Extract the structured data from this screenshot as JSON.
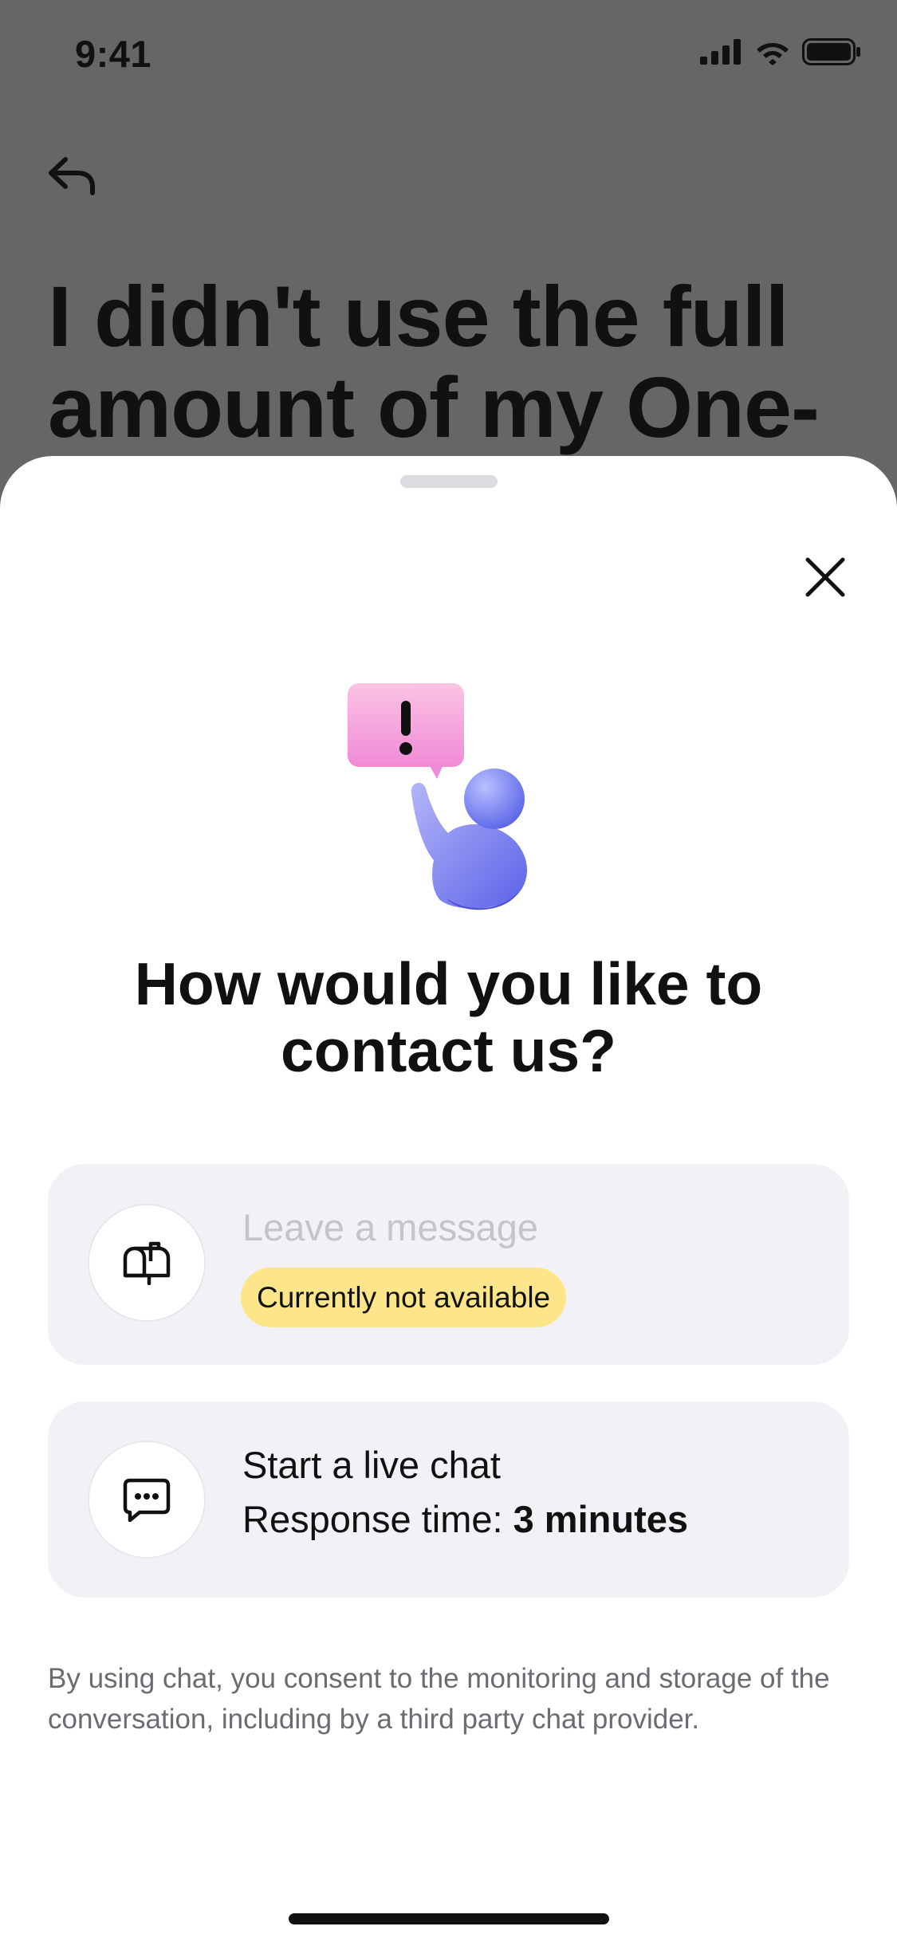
{
  "status_bar": {
    "time": "9:41",
    "icons": [
      "cellular-signal-icon",
      "wifi-icon",
      "battery-icon"
    ]
  },
  "background": {
    "back_icon": "back-arrow-icon",
    "title": "I didn't use the full amount of my One-"
  },
  "sheet": {
    "close_icon": "close-icon",
    "illustration": "support-person-alert-illustration",
    "title": "How would you like to contact us?",
    "options": [
      {
        "icon": "mailbox-icon",
        "title": "Leave a message",
        "badge": "Currently not available",
        "disabled": true
      },
      {
        "icon": "chat-bubble-icon",
        "title": "Start a live chat",
        "subtitle_prefix": "Response time: ",
        "subtitle_value": "3 minutes",
        "disabled": false
      }
    ],
    "disclaimer": "By using chat, you consent to the monitoring and storage of the conversation, including by a third party chat provider."
  },
  "colors": {
    "dim_overlay": "#666666",
    "sheet_background": "#ffffff",
    "card_background": "#f2f2f6",
    "badge_background": "#fde68a",
    "disabled_text": "#c4c4c9",
    "accent_purple": "#6c6ff0",
    "accent_pink": "#f48fd6"
  }
}
